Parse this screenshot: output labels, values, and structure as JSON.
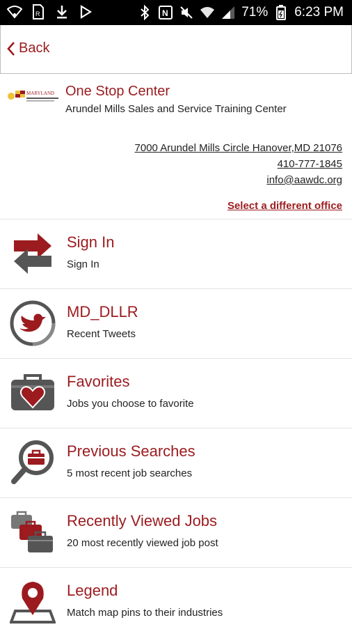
{
  "status_bar": {
    "battery": "71%",
    "time": "6:23 PM",
    "icons": [
      "wifi-icon",
      "sim-icon",
      "download-icon",
      "play-store-icon",
      "bluetooth-icon",
      "nfc-icon",
      "mute-icon",
      "wifi-signal-icon",
      "cell-signal-icon",
      "battery-icon"
    ]
  },
  "nav": {
    "back_label": "Back"
  },
  "office": {
    "name": "One Stop Center",
    "subtitle": "Arundel Mills Sales and Service Training Center",
    "address": "7000 Arundel Mills Circle Hanover,MD 21076",
    "phone": "410-777-1845",
    "email": "info@aawdc.org",
    "select_label": "Select a different office",
    "logo_text": "MARYLAND"
  },
  "menu": [
    {
      "title": "Sign In",
      "subtitle": "Sign In",
      "icon": "sign-in-arrows-icon"
    },
    {
      "title": "MD_DLLR",
      "subtitle": "Recent Tweets",
      "icon": "twitter-bird-icon"
    },
    {
      "title": "Favorites",
      "subtitle": "Jobs you choose to favorite",
      "icon": "briefcase-heart-icon"
    },
    {
      "title": "Previous Searches",
      "subtitle": "5 most recent job searches",
      "icon": "magnifier-briefcase-icon"
    },
    {
      "title": "Recently Viewed Jobs",
      "subtitle": "20 most recently viewed job post",
      "icon": "stacked-briefcases-icon"
    },
    {
      "title": "Legend",
      "subtitle": "Match map pins to their industries",
      "icon": "map-pin-icon"
    }
  ],
  "colors": {
    "accent": "#9b1b1f",
    "icon_gray": "#555555",
    "divider": "#e3e3e3"
  }
}
